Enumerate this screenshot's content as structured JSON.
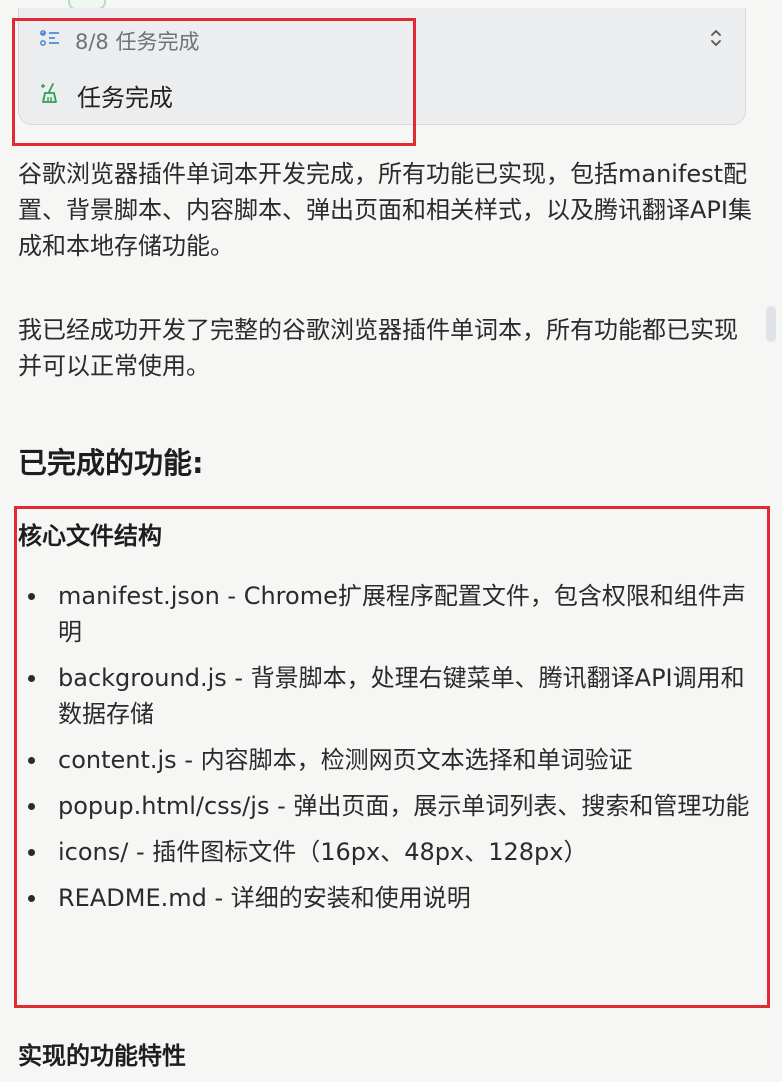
{
  "task_panel": {
    "progress": "8/8 任务完成",
    "status": "任务完成"
  },
  "summary": "谷歌浏览器插件单词本开发完成，所有功能已实现，包括manifest配置、背景脚本、内容脚本、弹出页面和相关样式，以及腾讯翻译API集成和本地存储功能。",
  "intro": "我已经成功开发了完整的谷歌浏览器插件单词本，所有功能都已实现并可以正常使用。",
  "section_title": "已完成的功能:",
  "core_files": {
    "title": "核心文件结构",
    "items": [
      "manifest.json - Chrome扩展程序配置文件，包含权限和组件声明",
      "background.js - 背景脚本，处理右键菜单、腾讯翻译API调用和数据存储",
      "content.js - 内容脚本，检测网页文本选择和单词验证",
      "popup.html/css/js - 弹出页面，展示单词列表、搜索和管理功能",
      "icons/ - 插件图标文件（16px、48px、128px）",
      "README.md - 详细的安装和使用说明"
    ]
  },
  "features_title": "实现的功能特性",
  "colors": {
    "highlight": "#e02a34",
    "accent_green": "#2e9e5b",
    "card_bg": "#ebedee"
  },
  "icons": {
    "task_list": "checklist-icon",
    "done": "broom-sparkle-icon",
    "expand": "chevron-up-down-icon"
  }
}
